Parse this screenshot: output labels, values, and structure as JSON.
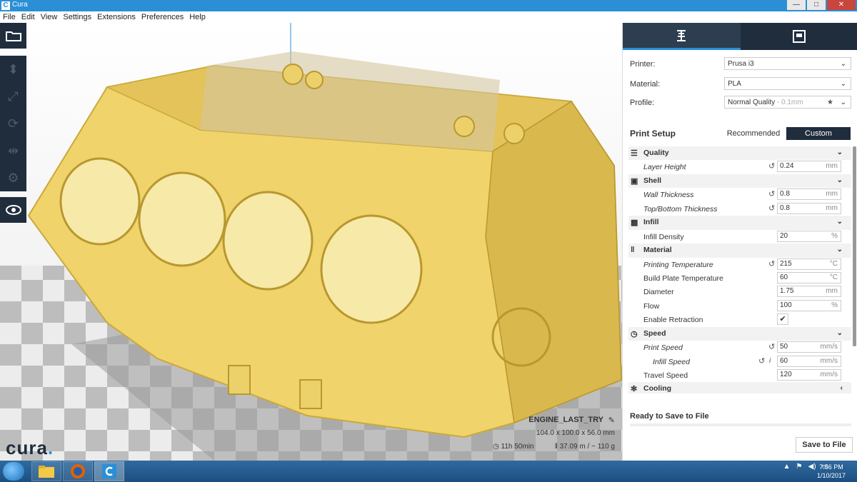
{
  "window": {
    "title": "Cura",
    "buttons": {
      "minimize": "—",
      "maximize": "□",
      "close": "✕"
    }
  },
  "menu": [
    "File",
    "Edit",
    "View",
    "Settings",
    "Extensions",
    "Preferences",
    "Help"
  ],
  "logo": {
    "text": "cura",
    "dot": "."
  },
  "job": {
    "name": "ENGINE_LAST_TRY",
    "dimensions": "104.0 x 100.0 x 56.0 mm",
    "time": "11h 50min",
    "material": "37.09 m / ~ 110 g"
  },
  "printer": {
    "label": "Printer:",
    "value": "Prusa i3",
    "material_label": "Material:",
    "material_value": "PLA",
    "profile_label": "Profile:",
    "profile_value": "Normal Quality",
    "profile_suffix": " - 0.1mm"
  },
  "setup": {
    "title": "Print Setup",
    "recommended": "Recommended",
    "custom": "Custom"
  },
  "settings": {
    "quality": {
      "name": "Quality",
      "layer_height": {
        "label": "Layer Height",
        "value": "0.24",
        "unit": "mm"
      }
    },
    "shell": {
      "name": "Shell",
      "wall_thickness": {
        "label": "Wall Thickness",
        "value": "0.8",
        "unit": "mm"
      },
      "top_bottom": {
        "label": "Top/Bottom Thickness",
        "value": "0.8",
        "unit": "mm"
      }
    },
    "infill": {
      "name": "Infill",
      "density": {
        "label": "Infill Density",
        "value": "20",
        "unit": "%"
      }
    },
    "material": {
      "name": "Material",
      "print_temp": {
        "label": "Printing Temperature",
        "value": "215",
        "unit": "°C"
      },
      "bed_temp": {
        "label": "Build Plate Temperature",
        "value": "60",
        "unit": "°C"
      },
      "diameter": {
        "label": "Diameter",
        "value": "1.75",
        "unit": "mm"
      },
      "flow": {
        "label": "Flow",
        "value": "100",
        "unit": "%"
      },
      "retraction": {
        "label": "Enable Retraction",
        "value": "✔"
      }
    },
    "speed": {
      "name": "Speed",
      "print_speed": {
        "label": "Print Speed",
        "value": "50",
        "unit": "mm/s"
      },
      "infill_speed": {
        "label": "Infill Speed",
        "value": "60",
        "unit": "mm/s"
      },
      "travel_speed": {
        "label": "Travel Speed",
        "value": "120",
        "unit": "mm/s"
      }
    },
    "cooling": {
      "name": "Cooling"
    }
  },
  "status": {
    "ready": "Ready to Save to File",
    "save_button": "Save to File"
  },
  "clock": {
    "time": "7:56 PM",
    "date": "1/10/2017"
  },
  "colors": {
    "model": "#f5d76e",
    "accent": "#2a8fd6",
    "dark": "#1f2d3d"
  }
}
